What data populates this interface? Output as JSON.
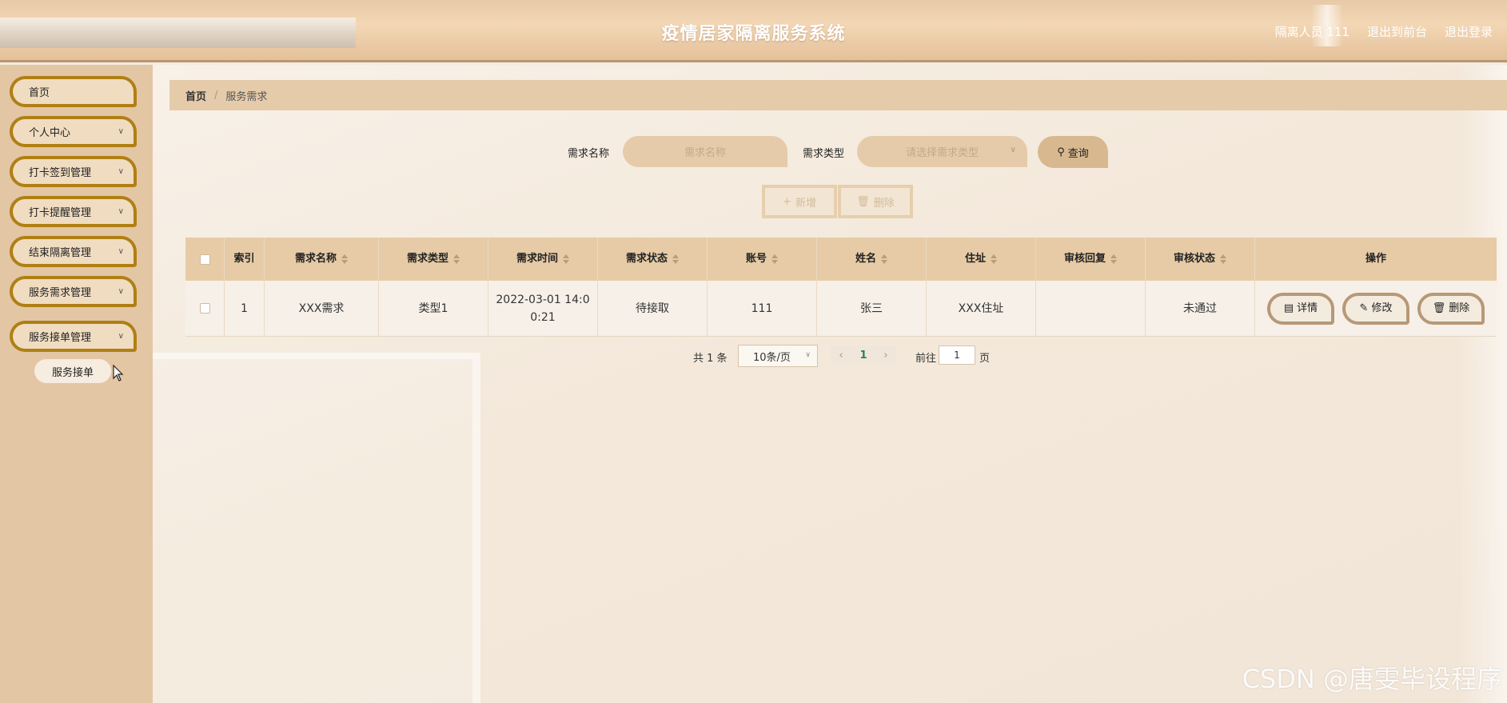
{
  "header": {
    "title": "疫情居家隔离服务系统",
    "user": "隔离人员 111",
    "to_front": "退出到前台",
    "logout": "退出登录"
  },
  "sidebar": {
    "items": [
      {
        "label": "首页"
      },
      {
        "label": "个人中心"
      },
      {
        "label": "打卡签到管理"
      },
      {
        "label": "打卡提醒管理"
      },
      {
        "label": "结束隔离管理"
      },
      {
        "label": "服务需求管理"
      },
      {
        "label": "服务接单管理"
      }
    ],
    "submenu": {
      "label": "服务接单"
    }
  },
  "breadcrumb": {
    "home": "首页",
    "separator": "/",
    "current": "服务需求"
  },
  "search": {
    "name_label": "需求名称",
    "name_placeholder": "需求名称",
    "type_label": "需求类型",
    "type_placeholder": "请选择需求类型",
    "query_label": "查询"
  },
  "actions": {
    "add_label": "新增",
    "delete_label": "删除"
  },
  "table": {
    "headers": [
      "索引",
      "需求名称",
      "需求类型",
      "需求时间",
      "需求状态",
      "账号",
      "姓名",
      "住址",
      "审核回复",
      "审核状态",
      "操作"
    ],
    "rows": [
      {
        "index": "1",
        "name": "XXX需求",
        "type": "类型1",
        "time": "2022-03-01 14:00:21",
        "status": "待接取",
        "account": "111",
        "person": "张三",
        "address": "XXX住址",
        "reply": "",
        "audit": "未通过",
        "ops": {
          "detail": "详情",
          "edit": "修改",
          "delete": "删除"
        }
      }
    ]
  },
  "pagination": {
    "total": "共 1 条",
    "page_size": "10条/页",
    "current_page": "1",
    "goto_label": "前往",
    "goto_value": "1",
    "page_unit": "页"
  },
  "watermark": "CSDN @唐雯毕设程序",
  "colors": {
    "accent": "#b07f14",
    "header_bg": "#e7c9a6",
    "table_head": "#e6cba6"
  }
}
